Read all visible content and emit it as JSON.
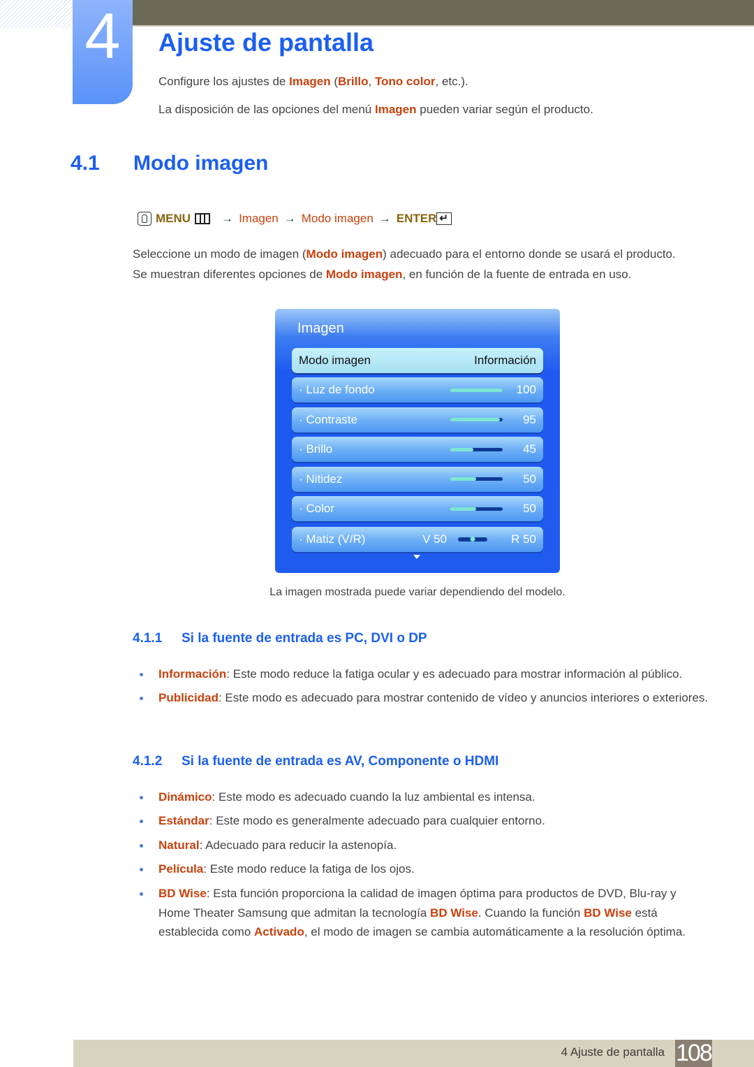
{
  "chapter": {
    "number": "4",
    "title": "Ajuste de pantalla",
    "intro": [
      {
        "parts": [
          {
            "text": "Configure los ajustes de ",
            "hl": false
          },
          {
            "text": "Imagen",
            "hl": true
          },
          {
            "text": " (",
            "hl": false
          },
          {
            "text": "Brillo",
            "hl": true
          },
          {
            "text": ", ",
            "hl": false
          },
          {
            "text": "Tono color",
            "hl": true
          },
          {
            "text": ", etc.).",
            "hl": false
          }
        ]
      },
      {
        "parts": [
          {
            "text": "La disposición de las opciones del menú ",
            "hl": false
          },
          {
            "text": "Imagen",
            "hl": true
          },
          {
            "text": " pueden variar según el producto.",
            "hl": false
          }
        ]
      }
    ]
  },
  "section": {
    "number": "4.1",
    "title": "Modo imagen",
    "menu_path": {
      "menu": "MENU",
      "arrow": "→",
      "steps": [
        "Imagen",
        "Modo imagen"
      ],
      "enter": "ENTER",
      "icons": [
        "remote-icon",
        "menu-icon",
        "enter-icon"
      ]
    },
    "paragraphs": [
      {
        "parts": [
          {
            "text": "Seleccione un modo de imagen (",
            "hl": false
          },
          {
            "text": "Modo imagen",
            "hl": true
          },
          {
            "text": ") adecuado para el entorno donde se usará el producto.",
            "hl": false
          }
        ]
      },
      {
        "parts": [
          {
            "text": "Se muestran diferentes opciones de ",
            "hl": false
          },
          {
            "text": "Modo imagen",
            "hl": true
          },
          {
            "text": ", en función de la fuente de entrada en uso.",
            "hl": false
          }
        ]
      }
    ]
  },
  "osd": {
    "title": "Imagen",
    "selected": {
      "label": "Modo imagen",
      "value": "Información"
    },
    "items": [
      {
        "label": "· Luz de fondo",
        "value": "100",
        "level": 1.0
      },
      {
        "label": "· Contraste",
        "value": "95",
        "level": 0.95
      },
      {
        "label": "· Brillo",
        "value": "45",
        "level": 0.45
      },
      {
        "label": "· Nitidez",
        "value": "50",
        "level": 0.5
      },
      {
        "label": "· Color",
        "value": "50",
        "level": 0.5
      }
    ],
    "tint": {
      "label": "· Matiz (V/R)",
      "left": "V 50",
      "right": "R 50",
      "position": 0.5
    },
    "more_icon": "down-triangle-icon"
  },
  "caption": "La imagen mostrada puede variar dependiendo del modelo.",
  "subsections": [
    {
      "number": "4.1.1",
      "title": "Si la fuente de entrada es PC, DVI o DP",
      "bullets": [
        [
          {
            "text": "Información",
            "hl": true
          },
          {
            "text": ": Este modo reduce la fatiga ocular y es adecuado para mostrar información al público.",
            "hl": false
          }
        ],
        [
          {
            "text": "Publicidad",
            "hl": true
          },
          {
            "text": ": Este modo es adecuado para mostrar contenido de vídeo y anuncios interiores o exteriores.",
            "hl": false
          }
        ]
      ]
    },
    {
      "number": "4.1.2",
      "title": "Si la fuente de entrada es AV, Componente o HDMI",
      "bullets": [
        [
          {
            "text": "Dinámico",
            "hl": true
          },
          {
            "text": ": Este modo es adecuado cuando la luz ambiental es intensa.",
            "hl": false
          }
        ],
        [
          {
            "text": "Estándar",
            "hl": true
          },
          {
            "text": ": Este modo es generalmente adecuado para cualquier entorno.",
            "hl": false
          }
        ],
        [
          {
            "text": "Natural",
            "hl": true
          },
          {
            "text": ": Adecuado para reducir la astenopía.",
            "hl": false
          }
        ],
        [
          {
            "text": "Película",
            "hl": true
          },
          {
            "text": ": Este modo reduce la fatiga de los ojos.",
            "hl": false
          }
        ],
        [
          {
            "text": "BD Wise",
            "hl": true
          },
          {
            "text": ": Esta función proporciona la calidad de imagen óptima para productos de DVD, Blu-ray y Home Theater Samsung que admitan la tecnología ",
            "hl": false
          },
          {
            "text": "BD Wise",
            "hl": true
          },
          {
            "text": ". Cuando la función ",
            "hl": false
          },
          {
            "text": "BD Wise",
            "hl": true
          },
          {
            "text": " está establecida como ",
            "hl": false
          },
          {
            "text": "Activado",
            "hl": true
          },
          {
            "text": ", el modo de imagen se cambia automáticamente a la resolución óptima.",
            "hl": false
          }
        ]
      ]
    }
  ],
  "footer": {
    "text": "4 Ajuste de pantalla",
    "page": "108"
  },
  "colors": {
    "heading_blue": "#1c5ff0",
    "highlight_orange": "#c9420e",
    "menu_gold": "#8a6410",
    "topbar": "#6b6a57",
    "footer_bg": "#d8d3bf",
    "page_box": "#8a7e72"
  }
}
